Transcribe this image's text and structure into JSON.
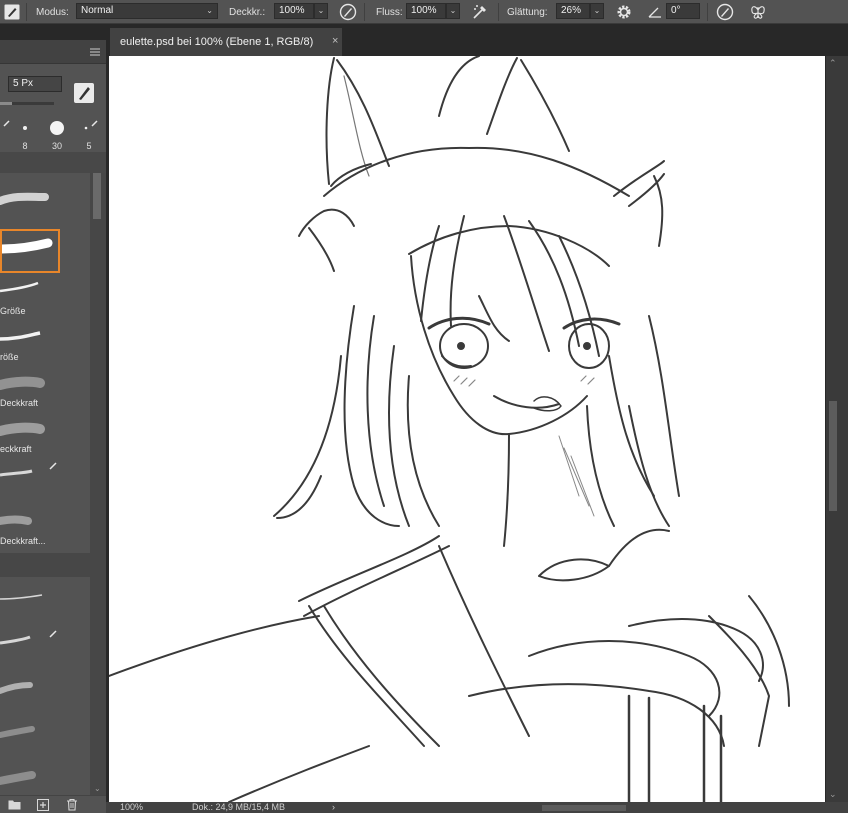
{
  "options_bar": {
    "tool_icon": "brush-tool-icon",
    "mode_label": "Modus:",
    "mode_value": "Normal",
    "opacity_label": "Deckkr.:",
    "opacity_value": "100%",
    "flow_label": "Fluss:",
    "flow_value": "100%",
    "smoothing_label": "Glättung:",
    "smoothing_value": "26%",
    "angle_value": "0°",
    "icons": [
      "pressure-opacity-icon",
      "airbrush-icon",
      "settings-gear-icon",
      "angle-icon",
      "pressure-size-icon",
      "symmetry-butterfly-icon"
    ]
  },
  "brush_panel": {
    "size_value": "5 Px",
    "presets": [
      {
        "label": ""
      },
      {
        "label": "8"
      },
      {
        "label": "30"
      },
      {
        "label": "5"
      }
    ],
    "brushes": [
      {
        "label": ""
      },
      {
        "label": ""
      },
      {
        "label": "Größe"
      },
      {
        "label": "röße"
      },
      {
        "label": "Deckkraft"
      },
      {
        "label": "eckkraft"
      },
      {
        "label": ""
      },
      {
        "label": "Deckkraft..."
      }
    ],
    "brushes_group2": [
      {
        "label": ""
      },
      {
        "label": ""
      },
      {
        "label": ""
      },
      {
        "label": ""
      },
      {
        "label": ""
      }
    ],
    "bottom_icons": [
      "folder-icon",
      "new-brush-icon",
      "trash-icon"
    ]
  },
  "document": {
    "tab_title": "eulette.psd bei 100% (Ebene 1, RGB/8)",
    "close_glyph": "×"
  },
  "status_bar": {
    "zoom": "100%",
    "doc_info": "Dok.: 24,9 MB/15,4 MB",
    "arrow": "›"
  },
  "colors": {
    "ui_bg": "#535353",
    "workspace": "#282828",
    "selection_accent": "#e8862a",
    "canvas": "#ffffff"
  }
}
